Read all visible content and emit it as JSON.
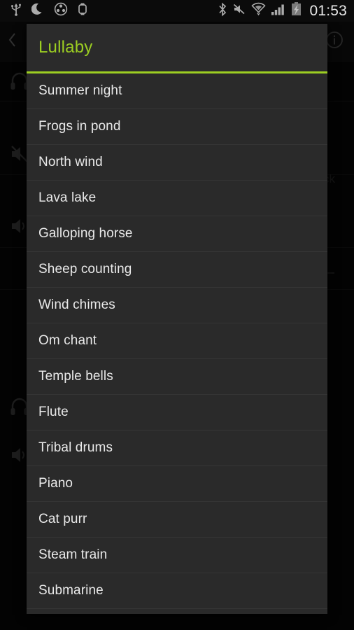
{
  "statusbar": {
    "time": "01:53",
    "left_icons": [
      {
        "name": "usb-icon",
        "label": "USB connected"
      },
      {
        "name": "moon-icon",
        "label": "Do not disturb"
      },
      {
        "name": "circle-cross-icon",
        "label": "Blocking mode"
      },
      {
        "name": "watch-icon",
        "label": "Connected wearable"
      }
    ],
    "right_icons": [
      {
        "name": "bluetooth-icon",
        "label": "Bluetooth"
      },
      {
        "name": "mute-icon",
        "label": "Sound muted"
      },
      {
        "name": "wifi-icon",
        "label": "Wi-Fi"
      },
      {
        "name": "signal-bars-icon",
        "label": "Mobile signal"
      },
      {
        "name": "battery-charging-icon",
        "label": "Battery charging"
      }
    ]
  },
  "background_app": {
    "back_icon": "back-chevron-icon",
    "app_logo_icon": "app-logo-icon",
    "info_icon": "info-icon",
    "partial_text": "ck",
    "rows": [
      {
        "icon": "headphones-icon"
      },
      {
        "icon": "speaker-muted-icon"
      },
      {
        "icon": "speaker-icon"
      },
      {
        "icon": "headphones-icon"
      },
      {
        "icon": "speaker-icon"
      }
    ]
  },
  "dialog": {
    "title": "Lullaby",
    "accent_color": "#9cce22",
    "background_color": "#2b2b2b",
    "items": [
      {
        "label": "Summer night"
      },
      {
        "label": "Frogs in pond"
      },
      {
        "label": "North wind"
      },
      {
        "label": "Lava lake"
      },
      {
        "label": "Galloping horse"
      },
      {
        "label": "Sheep counting"
      },
      {
        "label": "Wind chimes"
      },
      {
        "label": "Om chant"
      },
      {
        "label": "Temple bells"
      },
      {
        "label": "Flute"
      },
      {
        "label": "Tribal drums"
      },
      {
        "label": "Piano"
      },
      {
        "label": "Cat purr"
      },
      {
        "label": "Steam train"
      },
      {
        "label": "Submarine"
      }
    ]
  }
}
